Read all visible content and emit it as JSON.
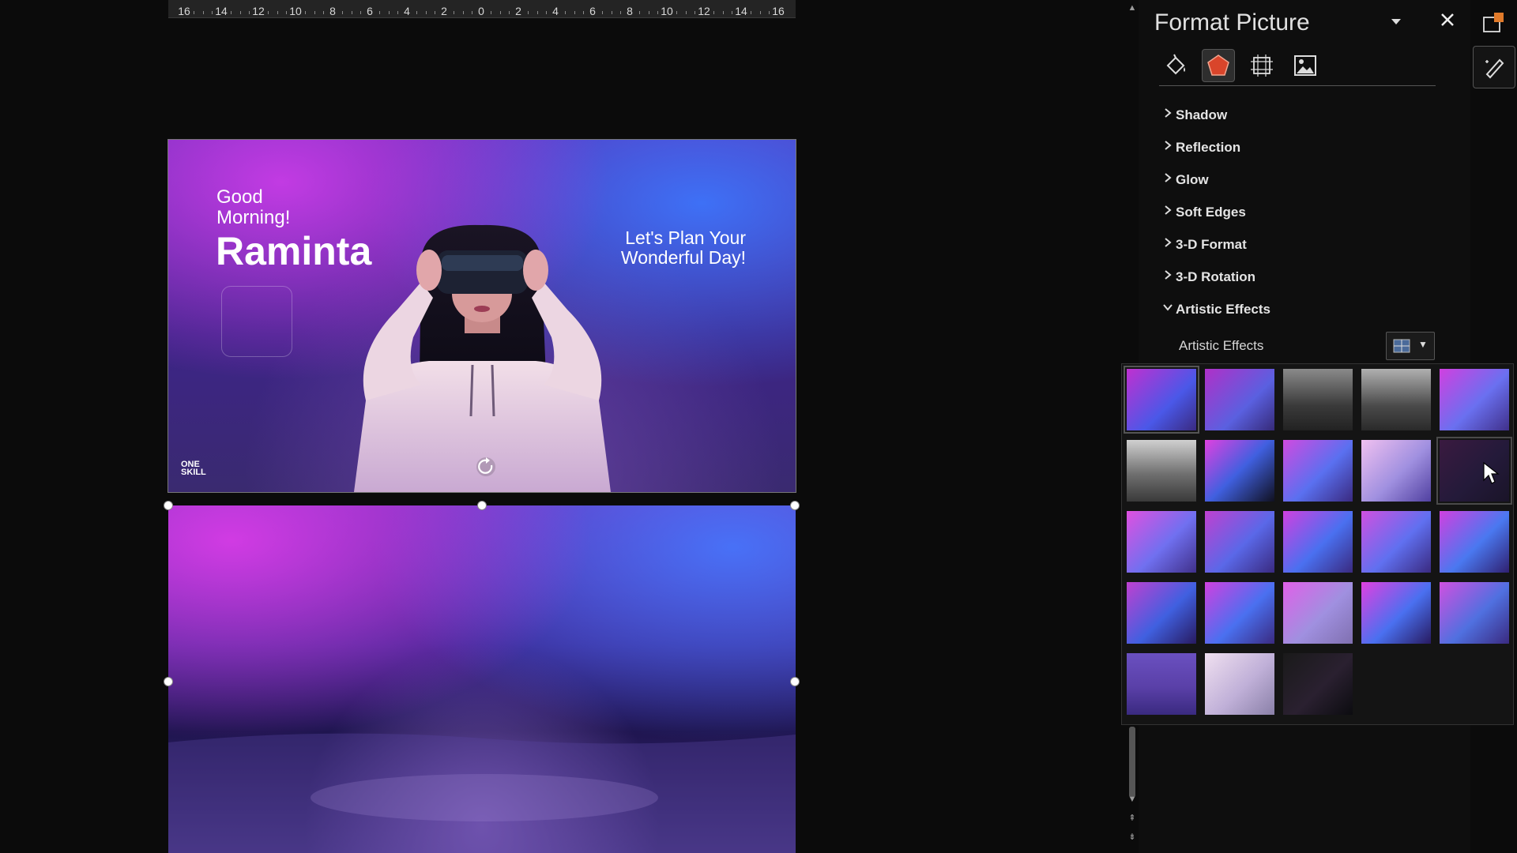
{
  "ruler": {
    "labels": [
      "16",
      "14",
      "12",
      "10",
      "8",
      "6",
      "4",
      "2",
      "0",
      "2",
      "4",
      "6",
      "8",
      "10",
      "12",
      "14",
      "16"
    ]
  },
  "slide": {
    "greeting": "Good Morning!",
    "greeting_line1": "Good",
    "greeting_line2": "Morning!",
    "name": "Raminta",
    "plan_line1": "Let's Plan Your",
    "plan_line2": "Wonderful Day!",
    "logo_line1": "ONE",
    "logo_line2": "SKILL"
  },
  "pane": {
    "title": "Format Picture",
    "tabs": [
      {
        "name": "fill-line-tab",
        "icon": "paint-bucket-icon"
      },
      {
        "name": "effects-tab",
        "icon": "pentagon-icon",
        "active": true
      },
      {
        "name": "size-properties-tab",
        "icon": "size-icon"
      },
      {
        "name": "picture-tab",
        "icon": "picture-icon"
      }
    ],
    "sections": [
      {
        "label": "Shadow",
        "expanded": false
      },
      {
        "label": "Reflection",
        "expanded": false
      },
      {
        "label": "Glow",
        "expanded": false
      },
      {
        "label": "Soft Edges",
        "expanded": false
      },
      {
        "label": "3-D Format",
        "expanded": false
      },
      {
        "label": "3-D Rotation",
        "expanded": false
      },
      {
        "label": "Artistic Effects",
        "expanded": true
      }
    ],
    "artistic_effects_label": "Artistic Effects",
    "accent_color": "#d9452b"
  },
  "gallery": {
    "rows": 5,
    "cols": 5,
    "count": 23,
    "selected_index": 0,
    "hover_index": 9
  }
}
